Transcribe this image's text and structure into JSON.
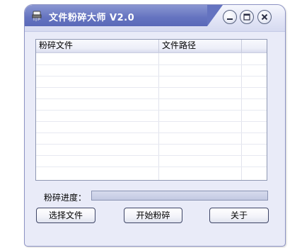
{
  "window": {
    "title": "文件粉碎大师 V2.0",
    "accent_color": "#5a69b8",
    "background_color": "#e9ebf8"
  },
  "title_controls": {
    "minimize_icon": "minimize-icon",
    "maximize_icon": "maximize-icon",
    "close_icon": "close-icon"
  },
  "file_list": {
    "columns": [
      {
        "label": "粉碎文件"
      },
      {
        "label": "文件路径"
      },
      {
        "label": ""
      }
    ],
    "rows": []
  },
  "progress": {
    "label": "粉碎进度：",
    "value": 0
  },
  "buttons": {
    "select_label": "选择文件",
    "start_label": "开始粉碎",
    "about_label": "关于"
  }
}
